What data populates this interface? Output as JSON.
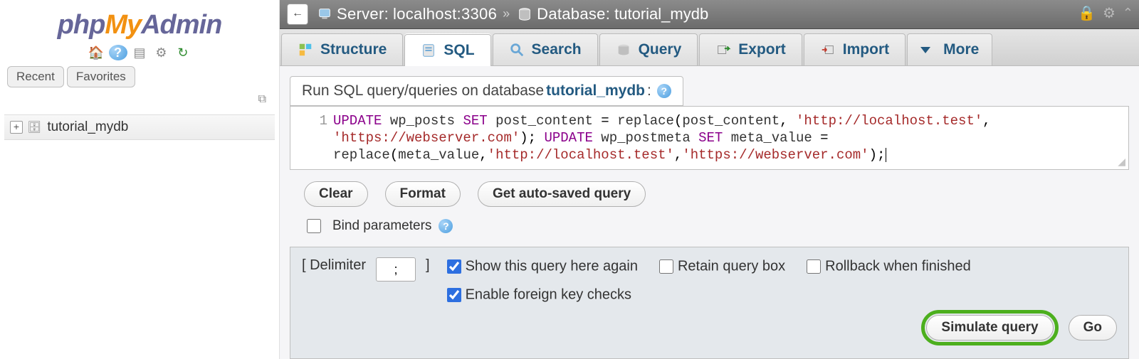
{
  "logo": {
    "p1": "php",
    "p2": "My",
    "p3": "Admin"
  },
  "sidebar_tabs": {
    "recent": "Recent",
    "favorites": "Favorites"
  },
  "tree": {
    "db": "tutorial_mydb"
  },
  "breadcrumb": {
    "server_label": "Server:",
    "server_value": "localhost:3306",
    "db_label": "Database:",
    "db_value": "tutorial_mydb"
  },
  "tabs": {
    "structure": "Structure",
    "sql": "SQL",
    "search": "Search",
    "query": "Query",
    "export": "Export",
    "import": "Import",
    "more": "More"
  },
  "panel": {
    "title_pre": "Run SQL query/queries on database ",
    "dbname": "tutorial_mydb",
    "title_post": ":"
  },
  "sql": {
    "line_no": "1",
    "kw_update": "UPDATE",
    "tbl1": "wp_posts",
    "kw_set": "SET",
    "col1": "post_content",
    "eq": " = ",
    "fn": "replace",
    "open": "(",
    "close": ")",
    "comma": ", ",
    "col1b": "post_content",
    "s1": "'http://localhost.test'",
    "s2": "'https://webserver.com'",
    "sc": ";",
    "kw_update2": "UPDATE",
    "tbl2": "wp_postmeta",
    "kw_set2": "SET",
    "col2": "meta_value",
    "eq2": " =",
    "col2b": "meta_value",
    "s3": "'http://localhost.test'",
    "s4": "'https://webserver.com'"
  },
  "actions": {
    "clear": "Clear",
    "format": "Format",
    "autosaved": "Get auto-saved query",
    "bind_params": "Bind parameters"
  },
  "bottom": {
    "delimiter_open": "[ Delimiter",
    "delimiter_close": "]",
    "delimiter_value": ";",
    "show_again": "Show this query here again",
    "retain": "Retain query box",
    "rollback": "Rollback when finished",
    "fk": "Enable foreign key checks",
    "simulate": "Simulate query",
    "go": "Go"
  }
}
